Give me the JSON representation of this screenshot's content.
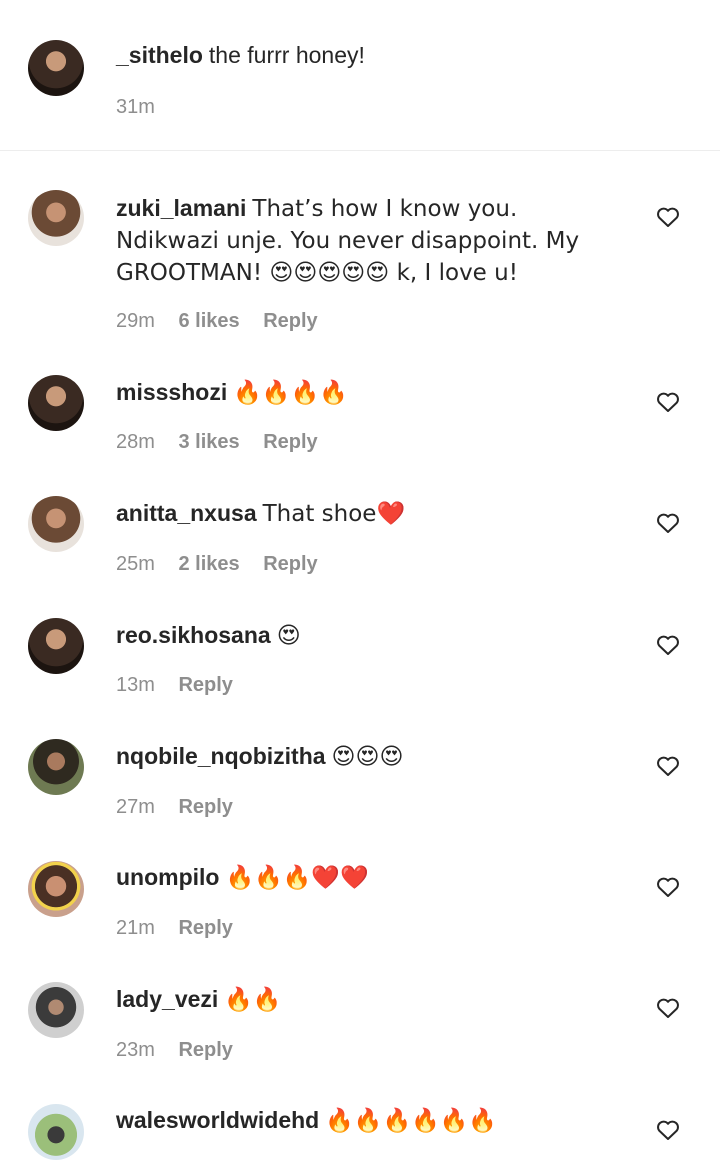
{
  "comments": [
    {
      "username": "_sithelo",
      "text": "the furrr honey!",
      "time": "31m",
      "likes": "",
      "reply": ""
    },
    {
      "username": "zuki_lamani",
      "text": "That’s how I know you. Ndikwazi unje. You never disappoint. My GROOTMAN! 😍😍😍😍😍 k, I love u!",
      "time": "29m",
      "likes": "6 likes",
      "reply": "Reply"
    },
    {
      "username": "missshozi",
      "text": "🔥🔥🔥🔥",
      "time": "28m",
      "likes": "3 likes",
      "reply": "Reply"
    },
    {
      "username": "anitta_nxusa",
      "text": "That shoe❤️",
      "time": "25m",
      "likes": "2 likes",
      "reply": "Reply"
    },
    {
      "username": "reo.sikhosana",
      "text": "😍",
      "time": "13m",
      "likes": "",
      "reply": "Reply"
    },
    {
      "username": "nqobile_nqobizitha",
      "text": "😍😍😍",
      "time": "27m",
      "likes": "",
      "reply": "Reply"
    },
    {
      "username": "unompilo",
      "text": "🔥🔥🔥❤️❤️",
      "time": "21m",
      "likes": "",
      "reply": "Reply"
    },
    {
      "username": "lady_vezi",
      "text": "🔥🔥",
      "time": "23m",
      "likes": "",
      "reply": "Reply"
    },
    {
      "username": "walesworldwidehd",
      "text": "🔥🔥🔥🔥🔥🔥",
      "time": "",
      "likes": "",
      "reply": ""
    }
  ],
  "icons": {
    "like": "heart-outline-icon"
  }
}
